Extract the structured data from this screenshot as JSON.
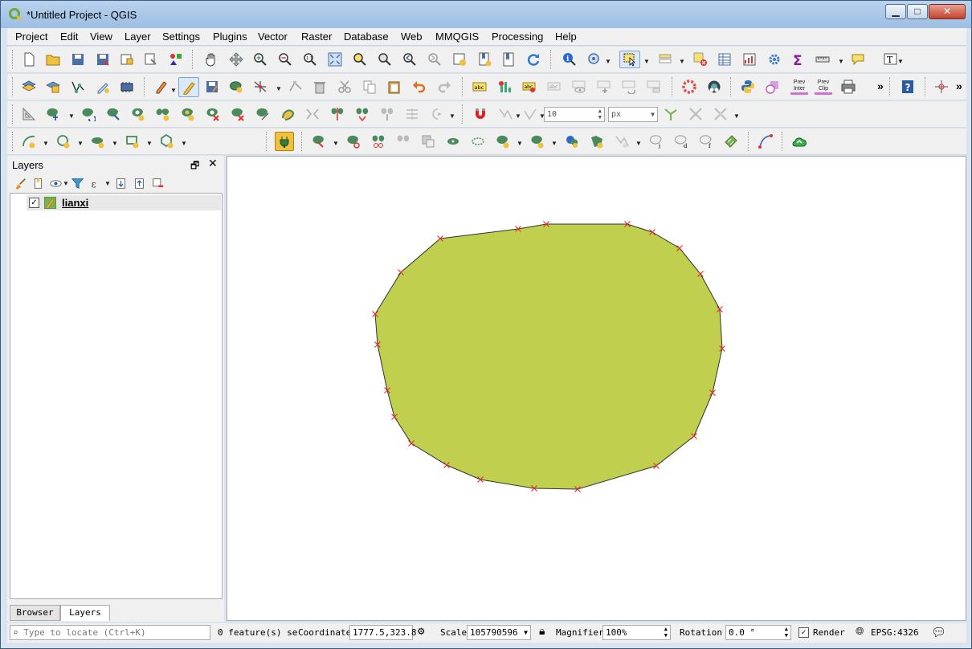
{
  "window": {
    "title": "*Untitled Project - QGIS"
  },
  "menu": [
    {
      "label": "Project",
      "mnemonic": "P"
    },
    {
      "label": "Edit",
      "mnemonic": "E"
    },
    {
      "label": "View",
      "mnemonic": "V"
    },
    {
      "label": "Layer",
      "mnemonic": "L"
    },
    {
      "label": "Settings",
      "mnemonic": "S"
    },
    {
      "label": "Plugins",
      "mnemonic": "P"
    },
    {
      "label": "Vector",
      "mnemonic": "o"
    },
    {
      "label": "Raster",
      "mnemonic": "R"
    },
    {
      "label": "Database",
      "mnemonic": "D"
    },
    {
      "label": "Web",
      "mnemonic": "W"
    },
    {
      "label": "MMQGIS",
      "mnemonic": ""
    },
    {
      "label": "Processing",
      "mnemonic": "c"
    },
    {
      "label": "Help",
      "mnemonic": "H"
    }
  ],
  "toolbar": {
    "snap_tolerance": "10",
    "snap_unit": "px",
    "prev_inter_label": "Prev Inter",
    "prev_clip_label": "Prev Clip",
    "overflow_label": "»"
  },
  "layers_panel": {
    "title": "Layers",
    "float_label": "🗗",
    "close_label": "✕",
    "layers": [
      {
        "name": "lianxi",
        "visible": true
      }
    ],
    "tabs": {
      "browser": "Browser",
      "layers": "Layers"
    }
  },
  "map": {
    "fill_color": "#c0cf4d",
    "stroke_color": "#333333",
    "vertex_color": "#e03030"
  },
  "status": {
    "locate_placeholder": "Type to locate (Ctrl+K)",
    "features_label": "0 feature(s) se",
    "coordinate_label": "Coordinate",
    "coordinate_value": "1777.5,323.8",
    "scale_label": "Scale",
    "scale_value": "105790596",
    "magnifier_label": "Magnifier",
    "magnifier_value": "100%",
    "rotation_label": "Rotation",
    "rotation_value": "0.0 °",
    "render_label": "Render",
    "crs_label": "EPSG:4326"
  }
}
